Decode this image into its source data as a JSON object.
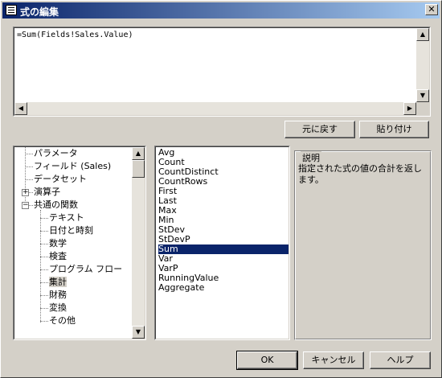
{
  "window": {
    "title": "式の編集",
    "close_glyph": "✕"
  },
  "editor": {
    "value": "=Sum(Fields!Sales.Value)"
  },
  "scroll_glyphs": {
    "up": "▲",
    "down": "▼",
    "left": "◀",
    "right": "▶"
  },
  "buttons": {
    "undo": "元に戻す",
    "paste": "貼り付け",
    "ok": "OK",
    "cancel": "キャンセル",
    "help": "ヘルプ"
  },
  "tree": {
    "items": [
      {
        "label": "パラメータ"
      },
      {
        "label": "フィールド (Sales)"
      },
      {
        "label": "データセット"
      },
      {
        "label": "演算子",
        "expander": "+"
      },
      {
        "label": "共通の関数",
        "expander": "−"
      },
      {
        "label": "テキスト"
      },
      {
        "label": "日付と時刻"
      },
      {
        "label": "数学"
      },
      {
        "label": "検査"
      },
      {
        "label": "プログラム フロー"
      },
      {
        "label": "集計"
      },
      {
        "label": "財務"
      },
      {
        "label": "変換"
      },
      {
        "label": "その他"
      }
    ],
    "selected": "集計"
  },
  "functions": {
    "items": [
      "Avg",
      "Count",
      "CountDistinct",
      "CountRows",
      "First",
      "Last",
      "Max",
      "Min",
      "StDev",
      "StDevP",
      "Sum",
      "Var",
      "VarP",
      "RunningValue",
      "Aggregate"
    ],
    "selected": "Sum"
  },
  "description": {
    "legend": "説明",
    "text": "指定された式の値の合計を返します。"
  }
}
